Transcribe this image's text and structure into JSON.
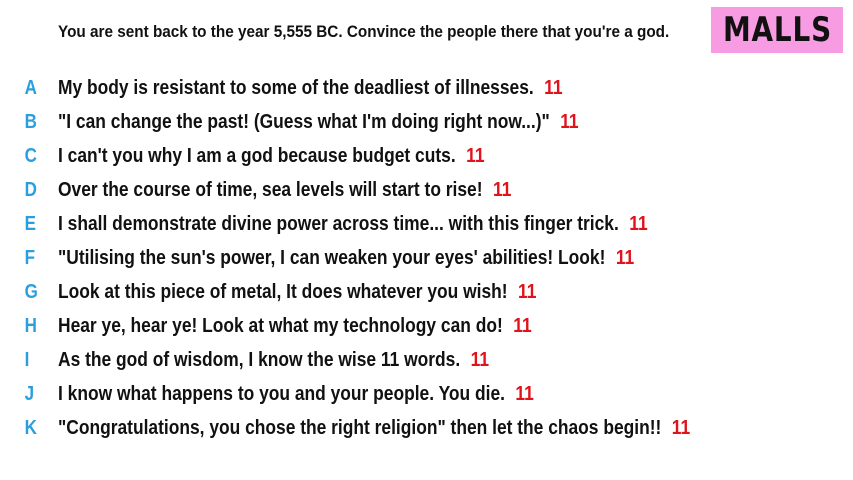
{
  "prompt": "You are sent back to the year 5,555 BC. Convince the people there that you're a god.",
  "logo": "MALLS",
  "colors": {
    "letter": "#2a9fe0",
    "score": "#e0121b",
    "logo_bg": "#f79ce3",
    "text": "#111111"
  },
  "answers": [
    {
      "letter": "A",
      "text": "My body is resistant to some of the deadliest of illnesses.",
      "score": "11"
    },
    {
      "letter": "B",
      "text": "\"I can change the past! (Guess what I'm doing right now...)\"",
      "score": "11"
    },
    {
      "letter": "C",
      "text": "I can't you why I am a god because budget cuts.",
      "score": "11"
    },
    {
      "letter": "D",
      "text": "Over the course of time, sea levels will start to rise!",
      "score": "11"
    },
    {
      "letter": "E",
      "text": "I shall demonstrate divine power across time... with this finger trick.",
      "score": "11"
    },
    {
      "letter": "F",
      "text": "\"Utilising the sun's power, I can weaken your eyes' abilities! Look!",
      "score": "11"
    },
    {
      "letter": "G",
      "text": "Look at this piece of metal, It does whatever you wish!",
      "score": "11"
    },
    {
      "letter": "H",
      "text": "Hear ye, hear ye! Look at what my technology can do!",
      "score": "11"
    },
    {
      "letter": "I",
      "text": "As the god of wisdom, I know the wise 11 words.",
      "score": "11"
    },
    {
      "letter": "J",
      "text": "I know what happens to you and your people. You die.",
      "score": "11"
    },
    {
      "letter": "K",
      "text": "\"Congratulations, you chose the right religion\" then let the chaos begin!!",
      "score": "11"
    }
  ]
}
